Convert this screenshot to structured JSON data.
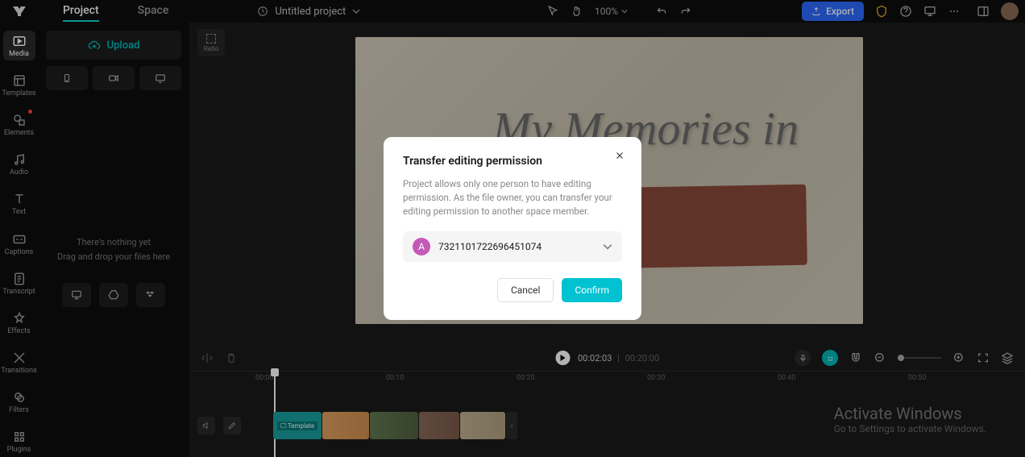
{
  "header": {
    "tabs": {
      "project": "Project",
      "space": "Space"
    },
    "project_name": "Untitled project",
    "zoom": "100%",
    "export": "Export"
  },
  "rail": {
    "media": "Media",
    "templates": "Templates",
    "elements": "Elements",
    "audio": "Audio",
    "text": "Text",
    "captions": "Captions",
    "transcript": "Transcript",
    "effects": "Effects",
    "transitions": "Transitions",
    "filters": "Filters",
    "plugins": "Plugins"
  },
  "panel": {
    "upload": "Upload",
    "empty_line1": "There's nothing yet",
    "empty_line2": "Drag and drop your files here"
  },
  "ratio_label": "Ratio",
  "preview": {
    "title_text": "My Memories in"
  },
  "playback": {
    "current": "00:02:03",
    "sep": "|",
    "duration": "00:20:00"
  },
  "ruler": [
    "00:00",
    "00:10",
    "00:20",
    "00:30",
    "00:40",
    "00:50"
  ],
  "clip_template_label": "Template",
  "modal": {
    "title": "Transfer editing permission",
    "desc": "Project allows only one person to have editing permission. As the file owner, you can transfer your editing permission to another space member.",
    "member_initial": "A",
    "member_id": "7321101722696451074",
    "cancel": "Cancel",
    "confirm": "Confirm"
  },
  "watermark": {
    "title": "Activate Windows",
    "sub": "Go to Settings to activate Windows."
  }
}
